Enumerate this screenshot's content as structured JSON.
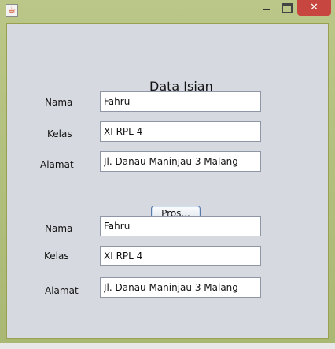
{
  "window": {
    "title": "",
    "icon": "java-cup-icon",
    "controls": {
      "minimize": "minimize-icon",
      "maximize": "maximize-icon",
      "close": "✕"
    }
  },
  "form": {
    "title": "Data Isian",
    "input_section": {
      "nama_label": "Nama",
      "nama_value": "Fahru",
      "kelas_label": "Kelas",
      "kelas_value": "XI RPL 4",
      "alamat_label": "Alamat",
      "alamat_value": "Jl. Danau Maninjau 3 Malang"
    },
    "process_button": "Pros...",
    "output_section": {
      "nama_label": "Nama",
      "nama_value": "Fahru",
      "kelas_label": "Kelas",
      "kelas_value": "XI RPL 4",
      "alamat_label": "Alamat",
      "alamat_value": "Jl. Danau Maninjau 3 Malang"
    }
  },
  "colors": {
    "frame": "#b5c27c",
    "panel": "#d6d9df",
    "close_button": "#c7463f"
  }
}
